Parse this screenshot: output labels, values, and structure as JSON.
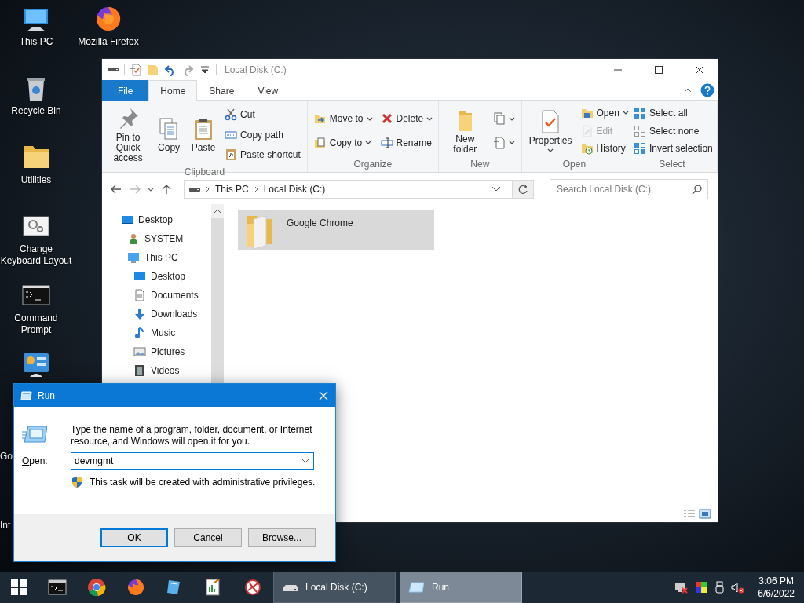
{
  "desktop_icons": [
    {
      "label": "This PC"
    },
    {
      "label": "Recycle Bin"
    },
    {
      "label": "Utilities"
    },
    {
      "label": "Change Keyboard Layout"
    },
    {
      "label": "Command Prompt"
    },
    {
      "label": "Go"
    },
    {
      "label": "Int"
    },
    {
      "label": "Mozilla Firefox"
    }
  ],
  "explorer": {
    "title": "Local Disk (C:)",
    "tabs": [
      {
        "label": "File",
        "kind": "menu",
        "selected": false
      },
      {
        "label": "Home",
        "kind": "tab",
        "selected": true
      },
      {
        "label": "Share",
        "kind": "tab",
        "selected": false
      },
      {
        "label": "View",
        "kind": "tab",
        "selected": false
      }
    ],
    "ribbon_groups": [
      {
        "label": "Clipboard",
        "columns": [
          [
            {
              "label": "Pin to Quick access",
              "kind": "large",
              "dropdown": false,
              "disabled": false
            }
          ],
          [
            {
              "label": "Copy",
              "kind": "large",
              "dropdown": false,
              "disabled": false
            }
          ],
          [
            {
              "label": "Paste",
              "kind": "large",
              "dropdown": false,
              "disabled": false
            }
          ],
          [
            {
              "label": "Cut",
              "kind": "small",
              "dropdown": false,
              "disabled": false
            },
            {
              "label": "Copy path",
              "kind": "small",
              "dropdown": false,
              "disabled": false
            },
            {
              "label": "Paste shortcut",
              "kind": "small",
              "dropdown": false,
              "disabled": false
            }
          ]
        ]
      },
      {
        "label": "Organize",
        "columns": [
          [
            {
              "label": "Move to",
              "kind": "small",
              "dropdown": true,
              "disabled": false
            },
            {
              "label": "Copy to",
              "kind": "small",
              "dropdown": true,
              "disabled": false
            }
          ],
          [
            {
              "label": "Delete",
              "kind": "small",
              "dropdown": true,
              "disabled": false
            },
            {
              "label": "Rename",
              "kind": "small",
              "dropdown": false,
              "disabled": false
            }
          ]
        ]
      },
      {
        "label": "New",
        "columns": [
          [
            {
              "label": "New folder",
              "kind": "large",
              "dropdown": false,
              "disabled": false
            }
          ],
          [
            {
              "kind": "icon",
              "dropdown": true,
              "disabled": false
            },
            {
              "kind": "icon",
              "dropdown": true,
              "disabled": false
            }
          ]
        ]
      },
      {
        "label": "Open",
        "columns": [
          [
            {
              "label": "Properties",
              "kind": "large",
              "dropdown": true,
              "disabled": false
            }
          ],
          [
            {
              "label": "Open",
              "kind": "small",
              "dropdown": true,
              "disabled": false
            },
            {
              "label": "Edit",
              "kind": "small",
              "dropdown": false,
              "disabled": true
            },
            {
              "label": "History",
              "kind": "small",
              "dropdown": false,
              "disabled": false
            }
          ]
        ]
      },
      {
        "label": "Select",
        "columns": [
          [
            {
              "label": "Select all",
              "kind": "small",
              "dropdown": false,
              "disabled": false
            },
            {
              "label": "Select none",
              "kind": "small",
              "dropdown": false,
              "disabled": false
            },
            {
              "label": "Invert selection",
              "kind": "small",
              "dropdown": false,
              "disabled": false
            }
          ]
        ]
      }
    ],
    "address": {
      "crumbs": [
        "This PC",
        "Local Disk (C:)"
      ]
    },
    "search": {
      "placeholder": "Search Local Disk (C:)"
    },
    "nav_tree": [
      {
        "label": "Desktop",
        "children": [
          {
            "label": "SYSTEM"
          },
          {
            "label": "This PC",
            "children": [
              {
                "label": "Desktop"
              },
              {
                "label": "Documents"
              },
              {
                "label": "Downloads"
              },
              {
                "label": "Music"
              },
              {
                "label": "Pictures"
              },
              {
                "label": "Videos"
              }
            ]
          }
        ]
      }
    ],
    "items": [
      {
        "name": "Google Chrome",
        "selected": true
      }
    ]
  },
  "run_dialog": {
    "title": "Run",
    "description": "Type the name of a program, folder, document, or Internet resource, and Windows will open it for you.",
    "open_label": "Open:",
    "value": "devmgmt",
    "note": "This task will be created with administrative privileges.",
    "buttons": [
      {
        "label": "OK",
        "default": true
      },
      {
        "label": "Cancel",
        "default": false
      },
      {
        "label": "Browse...",
        "default": false
      }
    ]
  },
  "taskbar": {
    "tasks": [
      {
        "label": "Local Disk (C:)",
        "selected": false
      },
      {
        "label": "Run",
        "selected": true
      }
    ],
    "time": "3:06 PM",
    "date": "6/6/2022"
  }
}
